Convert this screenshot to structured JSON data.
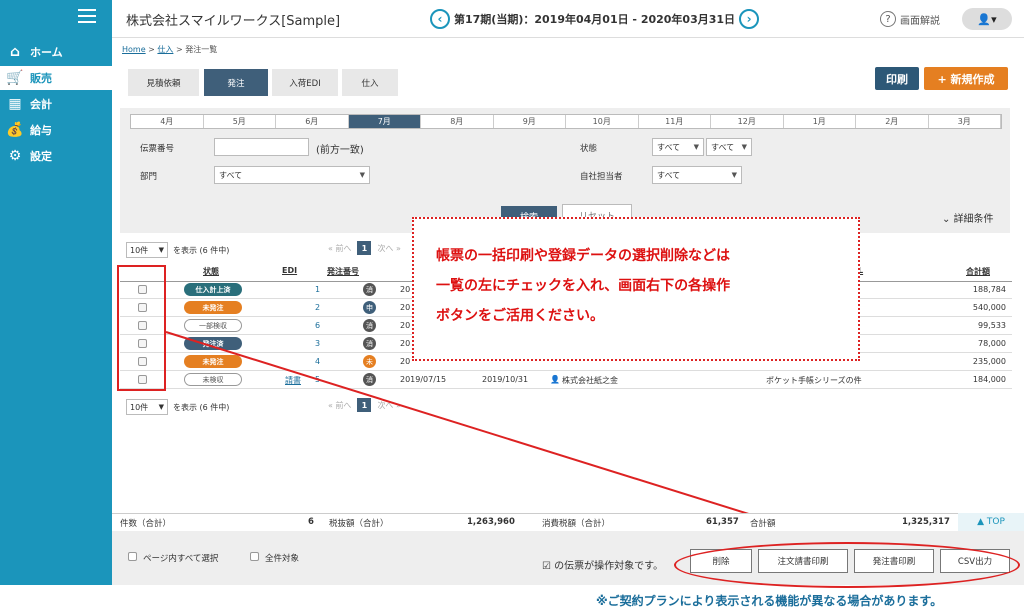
{
  "sidebar": {
    "items": [
      {
        "icon": "home-icon",
        "glyph": "⌂",
        "label": "ホーム",
        "active": false
      },
      {
        "icon": "cart-icon",
        "glyph": "🛒",
        "label": "販売",
        "active": true
      },
      {
        "icon": "calculator-icon",
        "glyph": "▦",
        "label": "会計",
        "active": false
      },
      {
        "icon": "moneybag-icon",
        "glyph": "💰",
        "label": "給与",
        "active": false
      },
      {
        "icon": "gear-icon",
        "glyph": "⚙",
        "label": "設定",
        "active": false
      }
    ]
  },
  "header": {
    "company": "株式会社スマイルワークス[Sample]",
    "period": "第17期(当期)：2019年04月01日 - 2020年03月31日",
    "help": "画面解説"
  },
  "breadcrumb": {
    "home": "Home",
    "sep": " > ",
    "purchase": "仕入",
    "current": "発注一覧"
  },
  "tabs": [
    "見積依頼",
    "発注",
    "入荷EDI",
    "仕入"
  ],
  "actions": {
    "print": "印刷",
    "new": "+ 新規作成"
  },
  "months": [
    "4月",
    "5月",
    "6月",
    "7月",
    "8月",
    "9月",
    "10月",
    "11月",
    "12月",
    "1月",
    "2月",
    "3月"
  ],
  "active_month": "7月",
  "filters": {
    "slip_label": "伝票番号",
    "slip_hint": "(前方一致)",
    "dept_label": "部門",
    "dept_value": "すべて",
    "status_label": "状態",
    "status_value1": "すべて",
    "status_value2": "すべて",
    "person_label": "自社担当者",
    "person_value": "すべて",
    "search": "検索",
    "reset": "リセット",
    "detail": "詳細条件"
  },
  "pagination": {
    "per_page": "10件",
    "showing": "を表示 (6 件中)",
    "prev": "« 前へ",
    "page": "1",
    "next": "次へ »"
  },
  "columns": {
    "status": "状態",
    "edi": "EDI",
    "number": "発注番号",
    "customer_tail": "L",
    "total": "合計額"
  },
  "rows": [
    {
      "status": "仕入計上済",
      "badge": "teal",
      "edi": "",
      "number": "1",
      "seal": "消",
      "sealc": "",
      "date1": "20",
      "date2": "",
      "vendor": "",
      "subject": "",
      "total": "188,784"
    },
    {
      "status": "未発注",
      "badge": "orange",
      "edi": "",
      "number": "2",
      "seal": "申",
      "sealc": "navy",
      "date1": "20",
      "date2": "",
      "vendor": "",
      "subject": "",
      "total": "540,000"
    },
    {
      "status": "一部検収",
      "badge": "out",
      "edi": "",
      "number": "6",
      "seal": "消",
      "sealc": "",
      "date1": "20",
      "date2": "",
      "vendor": "",
      "subject": "",
      "total": "99,533"
    },
    {
      "status": "発注済",
      "badge": "navy",
      "edi": "",
      "number": "3",
      "seal": "消",
      "sealc": "",
      "date1": "20",
      "date2": "",
      "vendor": "",
      "subject": "",
      "total": "78,000"
    },
    {
      "status": "未発注",
      "badge": "orange",
      "edi": "",
      "number": "4",
      "seal": "未",
      "sealc": "orange",
      "date1": "20",
      "date2": "",
      "vendor": "",
      "subject": "",
      "total": "235,000"
    },
    {
      "status": "未検収",
      "badge": "out",
      "edi": "請書",
      "number": "5",
      "seal": "消",
      "sealc": "",
      "date1": "2019/07/15",
      "date2": "2019/10/31",
      "vendor": "株式会社紙之金",
      "subject": "ポケット手帳シリーズの件",
      "total": "184,000"
    }
  ],
  "overlay": {
    "line1": "帳票の一括印刷や登録データの選択削除などは",
    "line2": "一覧の左にチェックを入れ、画面右下の各操作",
    "line3": "ボタンをご活用ください。"
  },
  "totals": {
    "count_label": "件数（合計）",
    "count": "6",
    "excl_label": "税抜額（合計）",
    "excl": "1,263,960",
    "tax_label": "消費税額（合計）",
    "tax": "61,357",
    "total_label": "合計額",
    "total": "1,325,317",
    "top": "▲ TOP"
  },
  "footer": {
    "select_page": "ページ内すべて選択",
    "select_all": "全件対象",
    "target_text": "の伝票が操作対象です。",
    "buttons": [
      "削除",
      "注文請書印刷",
      "発注書印刷",
      "CSV出力"
    ],
    "note": "※ご契約プランにより表示される機能が異なる場合があります。"
  }
}
